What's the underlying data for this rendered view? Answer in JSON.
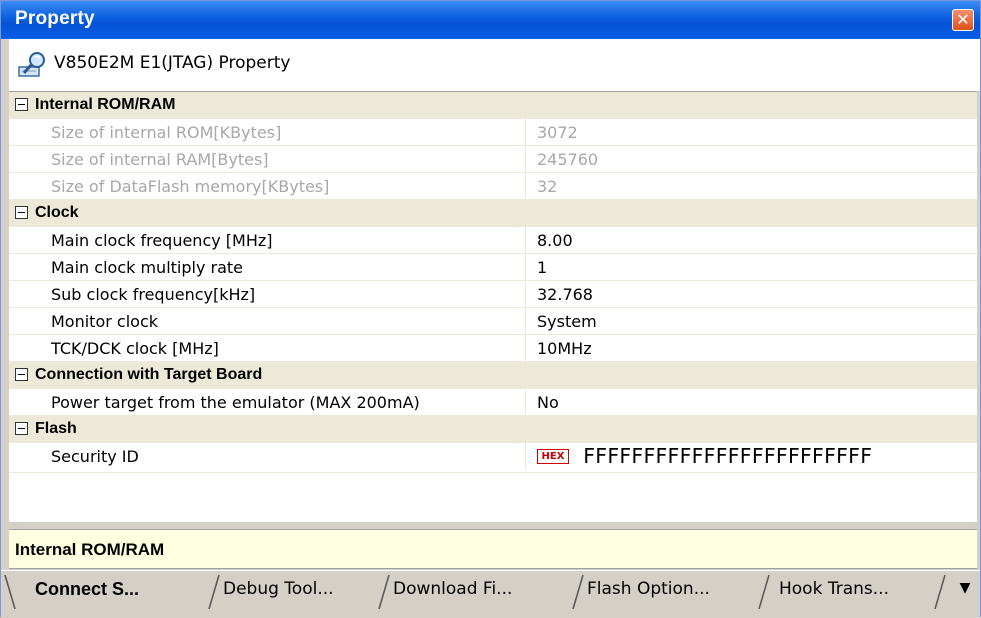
{
  "window": {
    "title": "Property",
    "close_glyph": "✕"
  },
  "header": {
    "icon": "property-tool-icon",
    "text": "V850E2M E1(JTAG) Property"
  },
  "categories": [
    {
      "label": "Internal ROM/RAM",
      "rows": [
        {
          "name": "Size of internal ROM[KBytes]",
          "value": "3072",
          "disabled": true
        },
        {
          "name": "Size of internal RAM[Bytes]",
          "value": "245760",
          "disabled": true
        },
        {
          "name": "Size of DataFlash memory[KBytes]",
          "value": "32",
          "disabled": true
        }
      ]
    },
    {
      "label": "Clock",
      "rows": [
        {
          "name": "Main clock frequency [MHz]",
          "value": "8.00"
        },
        {
          "name": "Main clock multiply rate",
          "value": "1"
        },
        {
          "name": "Sub clock frequency[kHz]",
          "value": "32.768"
        },
        {
          "name": "Monitor clock",
          "value": "System"
        },
        {
          "name": "TCK/DCK clock [MHz]",
          "value": "10MHz"
        }
      ]
    },
    {
      "label": "Connection with Target Board",
      "rows": [
        {
          "name": "Power target from the emulator (MAX 200mA)",
          "value": "No"
        }
      ]
    },
    {
      "label": "Flash",
      "rows": [
        {
          "name": "Security ID",
          "badge": "HEX",
          "value": "FFFFFFFFFFFFFFFFFFFFFFFF"
        }
      ]
    }
  ],
  "description": {
    "text": "Internal ROM/RAM"
  },
  "tabs": [
    {
      "label": "Connect S...",
      "active": true
    },
    {
      "label": "Debug Tool..."
    },
    {
      "label": "Download Fi..."
    },
    {
      "label": "Flash Option..."
    },
    {
      "label": "Hook Trans..."
    }
  ],
  "tab_overflow": {
    "icon": "tab-list-icon",
    "glyph": "▼"
  },
  "colors": {
    "title_bar": "#0553d6",
    "category_bg": "#ece9d8",
    "description_bg": "#ffffe1",
    "hex_badge": "#cc0000",
    "disabled_text": "#a8a8a8"
  }
}
